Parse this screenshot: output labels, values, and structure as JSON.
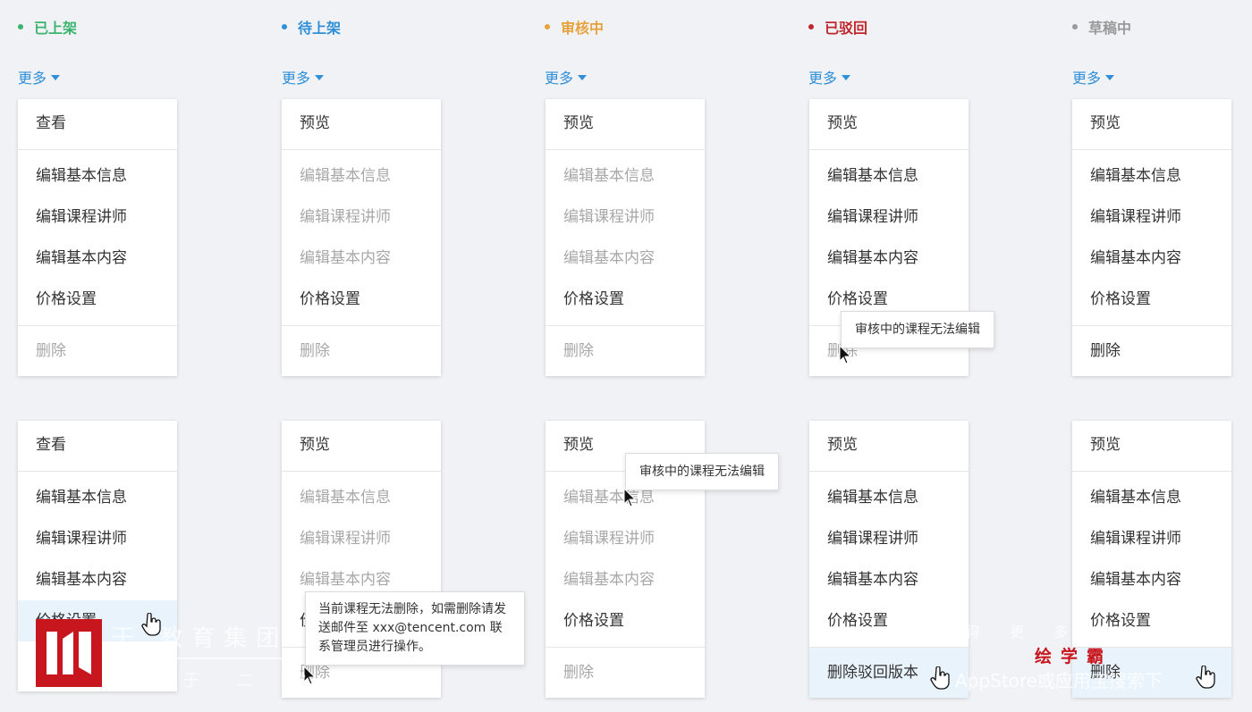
{
  "columns": [
    {
      "status": "已上架",
      "color": "#3cb46e"
    },
    {
      "status": "待上架",
      "color": "#2f8fd8"
    },
    {
      "status": "审核中",
      "color": "#e6a23c"
    },
    {
      "status": "已驳回",
      "color": "#c0272d"
    },
    {
      "status": "草稿中",
      "color": "#999999"
    }
  ],
  "more_label": "更多",
  "menus": {
    "m0a": [
      "查看",
      "编辑基本信息",
      "编辑课程讲师",
      "编辑基本内容",
      "价格设置",
      "删除"
    ],
    "m1a": [
      "预览",
      "编辑基本信息",
      "编辑课程讲师",
      "编辑基本内容",
      "价格设置",
      "删除"
    ],
    "m2a": [
      "预览",
      "编辑基本信息",
      "编辑课程讲师",
      "编辑基本内容",
      "价格设置",
      "删除"
    ],
    "m3a": [
      "预览",
      "编辑基本信息",
      "编辑课程讲师",
      "编辑基本内容",
      "价格设置",
      "删除"
    ],
    "m4a": [
      "预览",
      "编辑基本信息",
      "编辑课程讲师",
      "编辑基本内容",
      "价格设置",
      "删除"
    ],
    "m0b": [
      "查看",
      "编辑基本信息",
      "编辑课程讲师",
      "编辑基本内容",
      "价格设置"
    ],
    "m1b": [
      "预览",
      "编辑基本信息",
      "编辑课程讲师",
      "编辑基本内容",
      "价",
      "删除"
    ],
    "m2b": [
      "预览",
      "编辑基本信息",
      "编辑课程讲师",
      "编辑基本内容",
      "价格设置",
      "删除"
    ],
    "m3b": [
      "预览",
      "编辑基本信息",
      "编辑课程讲师",
      "编辑基本内容",
      "价格设置",
      "删除驳回版本"
    ],
    "m4b": [
      "预览",
      "编辑基本信息",
      "编辑课程讲师",
      "编辑基本内容",
      "价格设置",
      "删除"
    ]
  },
  "tooltips": {
    "edit_disabled": "审核中的课程无法编辑",
    "delete_disabled": "当前课程无法删除，如需删除请发送邮件至 xxx@tencent.com 联系管理员进行操作。"
  },
  "watermark": {
    "group_name": "于 教育集团",
    "sub_text": "于 二 零",
    "brand": "绘学霸",
    "top_right": "得 更 多 免",
    "bottom_right": "AppStore或应用宝搜索下"
  },
  "icons": {
    "cursor": "arrow-cursor-icon",
    "hand": "hand-cursor-icon",
    "logo": "logo-icon",
    "caret": "caret-down-icon"
  }
}
